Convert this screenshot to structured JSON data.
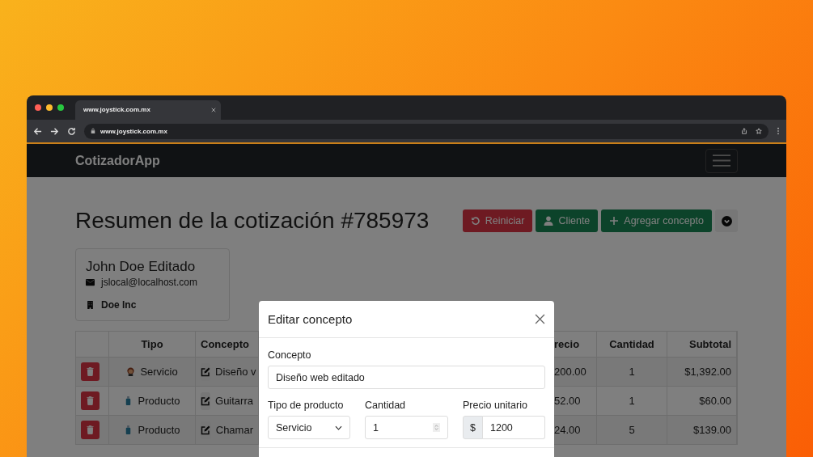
{
  "browser": {
    "tab_title": "www.joystick.com.mx",
    "url": "www.joystick.com.mx"
  },
  "navbar": {
    "brand": "CotizadorApp"
  },
  "heading": "Resumen de la cotización #785973",
  "actions": [
    {
      "label": "Reiniciar",
      "kind": "reset"
    },
    {
      "label": "Cliente",
      "kind": "client"
    },
    {
      "label": "Agregar concepto",
      "kind": "add"
    }
  ],
  "client": {
    "name": "John Doe Editado",
    "email": "jslocal@localhost.com",
    "company": "Doe Inc"
  },
  "table": {
    "columns": [
      "Tipo",
      "Concepto",
      "recio",
      "Cantidad",
      "Subtotal"
    ],
    "rows": [
      {
        "kind": "service",
        "tipo": "Servicio",
        "concepto": "Diseño v",
        "precio": "200.00",
        "cantidad": "1",
        "subtotal": "$1,392.00"
      },
      {
        "kind": "product",
        "tipo": "Producto",
        "concepto": "Guitarra",
        "precio": "52.00",
        "cantidad": "1",
        "subtotal": "$60.00"
      },
      {
        "kind": "product",
        "tipo": "Producto",
        "concepto": "Chamar",
        "precio": "24.00",
        "cantidad": "5",
        "subtotal": "$139.00"
      }
    ]
  },
  "modal": {
    "title": "Editar concepto",
    "concepto_label": "Concepto",
    "concepto_value": "Diseño web editado",
    "tipo_label": "Tipo de producto",
    "tipo_value": "Servicio",
    "cantidad_label": "Cantidad",
    "cantidad_value": "1",
    "precio_label": "Precio unitario",
    "currency": "$",
    "precio_value": "1200"
  }
}
